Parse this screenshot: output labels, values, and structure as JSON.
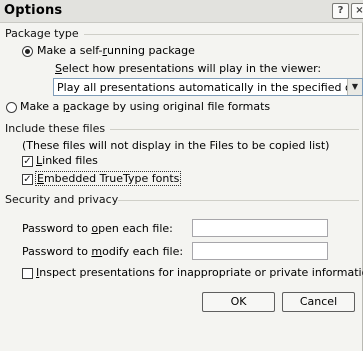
{
  "window": {
    "title": "Options",
    "help_button": "?",
    "close_button": "×"
  },
  "package_type": {
    "heading": "Package type",
    "self_running": {
      "label": "Make a self-running package",
      "checked": true
    },
    "viewer_prompt": "Select how presentations will play in the viewer:",
    "viewer_select": {
      "value": "Play all presentations automatically in the specified order"
    },
    "original_formats": {
      "label": "Make a package by using original file formats",
      "checked": false
    }
  },
  "include_files": {
    "heading": "Include these files",
    "note": "(These files will not display in the Files to be copied list)",
    "linked_files": {
      "label": "Linked files",
      "checked": true
    },
    "truetype_fonts": {
      "label": "Embedded TrueType fonts",
      "checked": true
    }
  },
  "security": {
    "heading": "Security and privacy",
    "open_password": {
      "label": "Password to open each file:",
      "value": ""
    },
    "modify_password": {
      "label": "Password to modify each file:",
      "value": ""
    },
    "inspect": {
      "label": "Inspect presentations for inappropriate or private information",
      "checked": false
    }
  },
  "buttons": {
    "ok": "OK",
    "cancel": "Cancel"
  }
}
